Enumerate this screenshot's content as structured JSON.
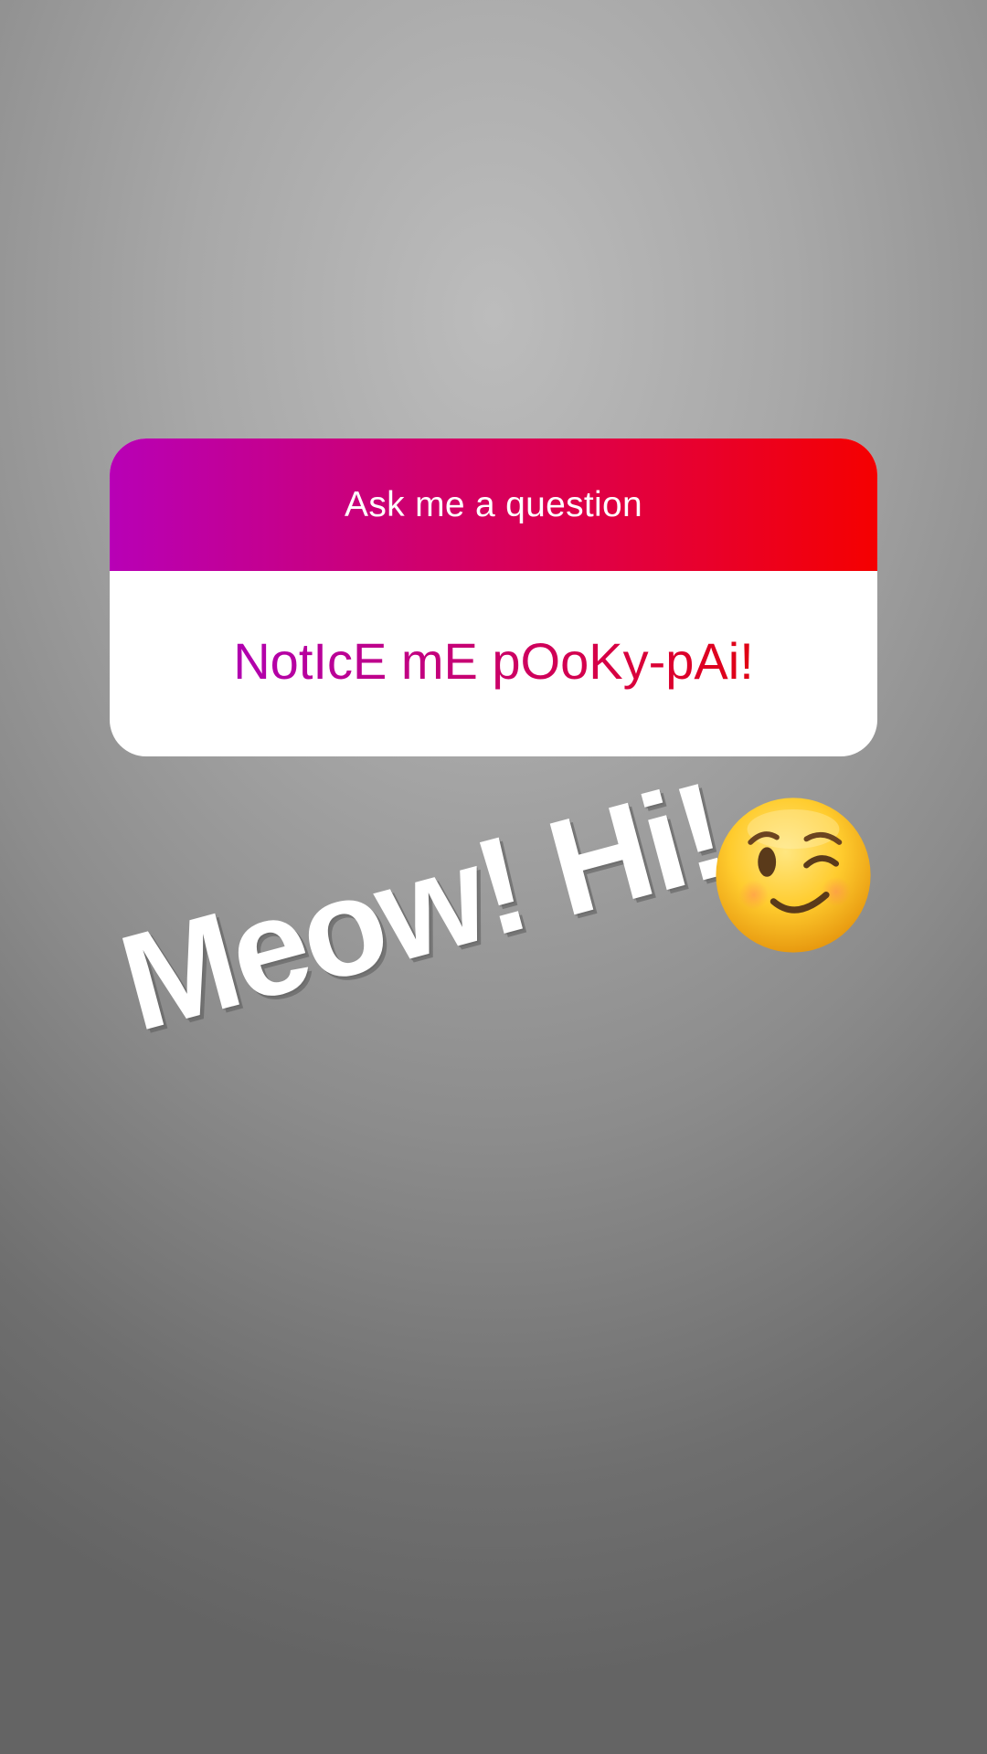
{
  "story": {
    "question_sticker": {
      "prompt": "Ask me a question",
      "answer": "NotIcE mE pOoKy-pAi!",
      "header_gradient": [
        "#b800b6",
        "#f50000"
      ]
    },
    "overlay_text": "Meow! Hi!",
    "emoji": "winking-face"
  }
}
